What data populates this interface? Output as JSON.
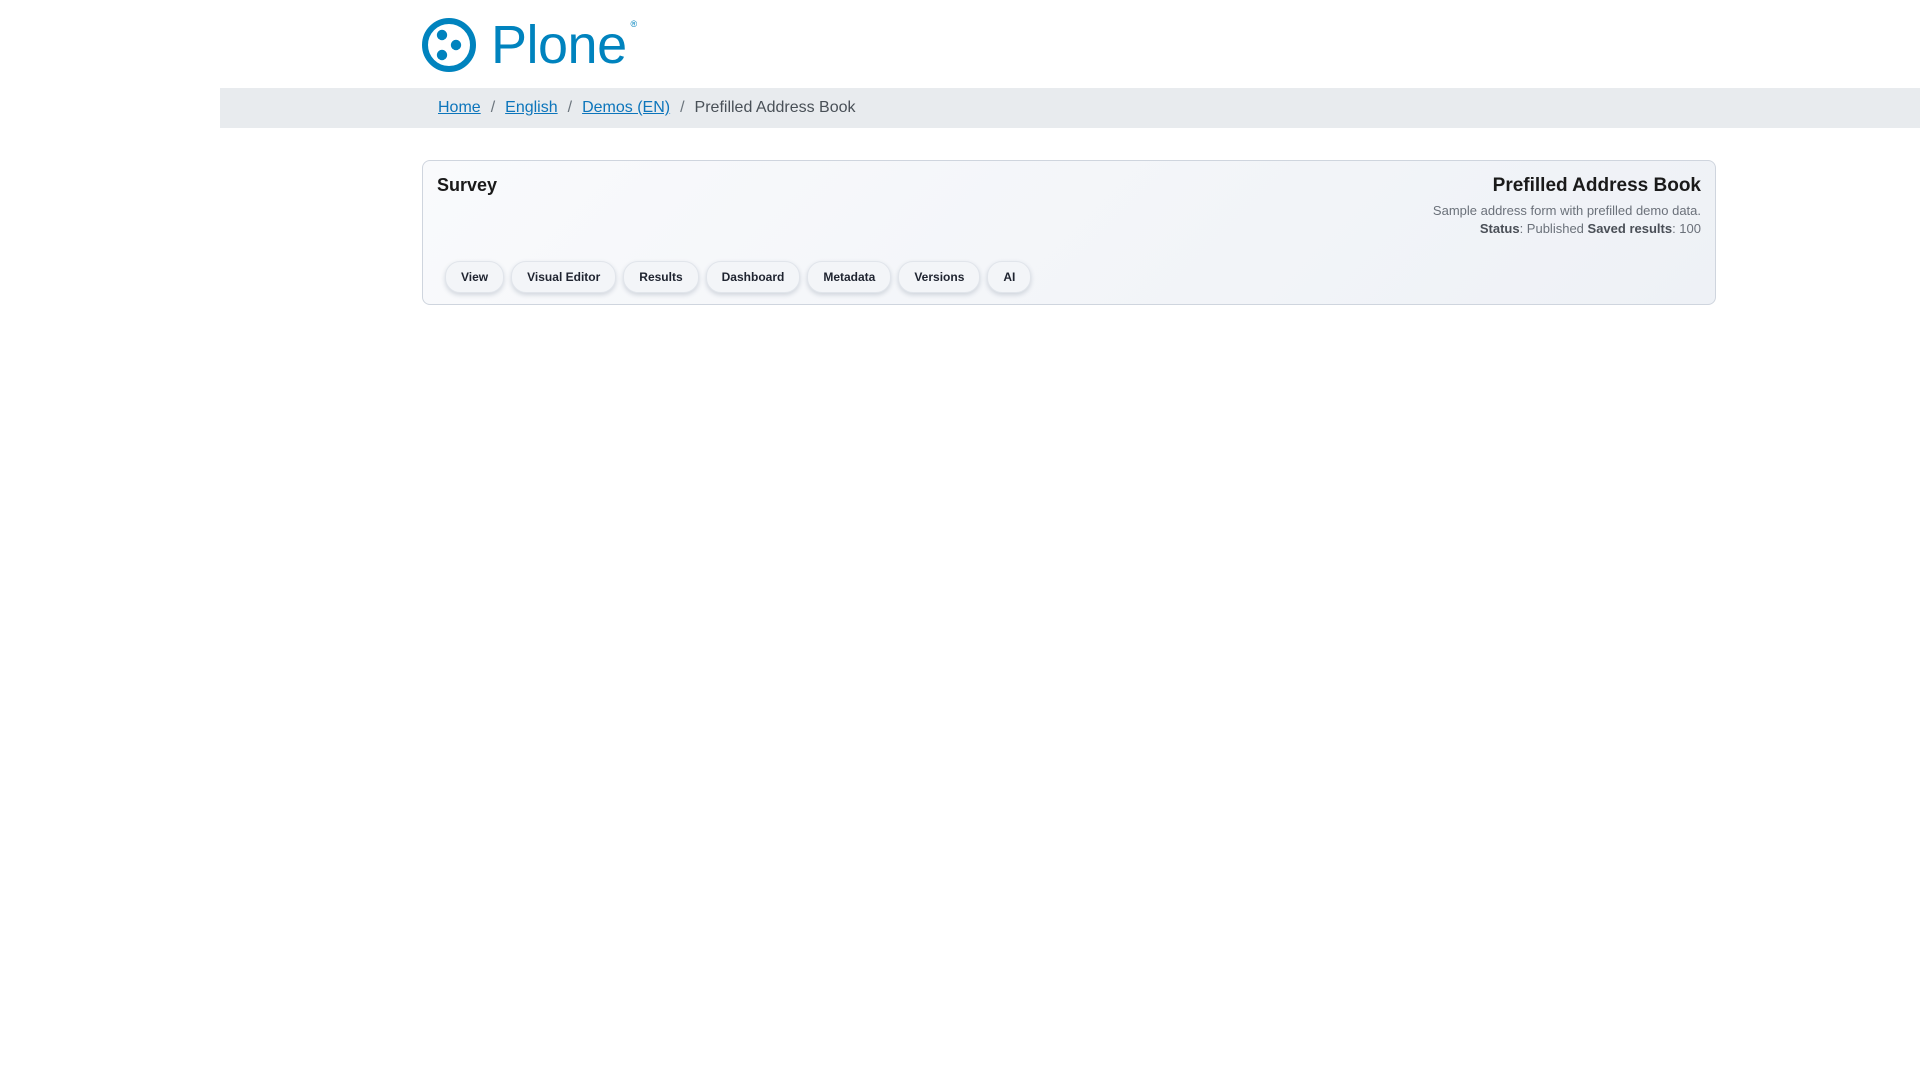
{
  "brand": {
    "logo_text": "Plone",
    "logo_registered": "®",
    "color": "#0083be"
  },
  "breadcrumb": {
    "links": [
      "Home",
      "English",
      "Demos (EN)"
    ],
    "separator": "/",
    "current": "Prefilled Address Book"
  },
  "card": {
    "kicker": "Survey",
    "title": "Prefilled Address Book",
    "description": "Sample address form with prefilled demo data.",
    "status_label": "Status",
    "status_value": ": Published",
    "results_label": "Saved results",
    "results_value": ": 100"
  },
  "tabs": [
    "View",
    "Visual Editor",
    "Results",
    "Dashboard",
    "Metadata",
    "Versions",
    "AI"
  ]
}
